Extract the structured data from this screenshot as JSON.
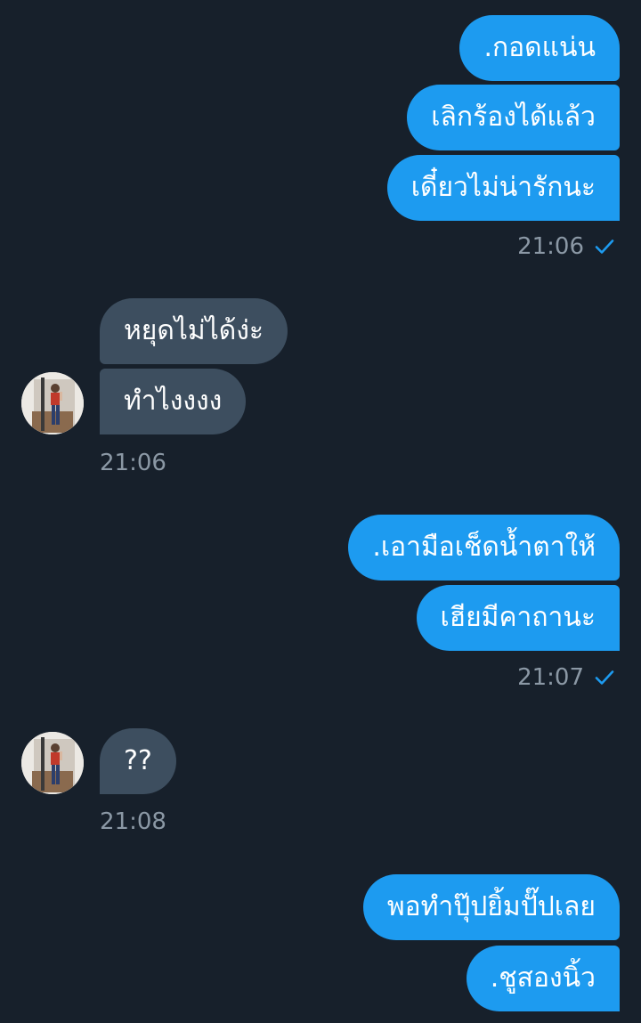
{
  "colors": {
    "background": "#17202b",
    "outgoing_bubble": "#1d9bf0",
    "incoming_bubble": "#3d4e5f",
    "timestamp": "#8b98a5",
    "read_check": "#1d9bf0"
  },
  "messages": {
    "m1": ".กอดแน่น",
    "m2": "เลิกร้องได้แล้ว",
    "m3": "เดี๋ยวไม่น่ารักนะ",
    "t1": "21:06",
    "m4": "หยุดไม่ได้ง่ะ",
    "m5": "ทำไงงงง",
    "t2": "21:06",
    "m6": ".เอามือเช็ดน้ำตาให้",
    "m7": "เฮียมีคาถานะ",
    "t3": "21:07",
    "m8": "??",
    "t4": "21:08",
    "m9": "พอทำปุ๊ปยิ้มปั๊ปเลย",
    "m10": ".ชูสองนิ้ว"
  },
  "icons": {
    "read_receipt": "check-icon",
    "contact_avatar": "avatar"
  }
}
